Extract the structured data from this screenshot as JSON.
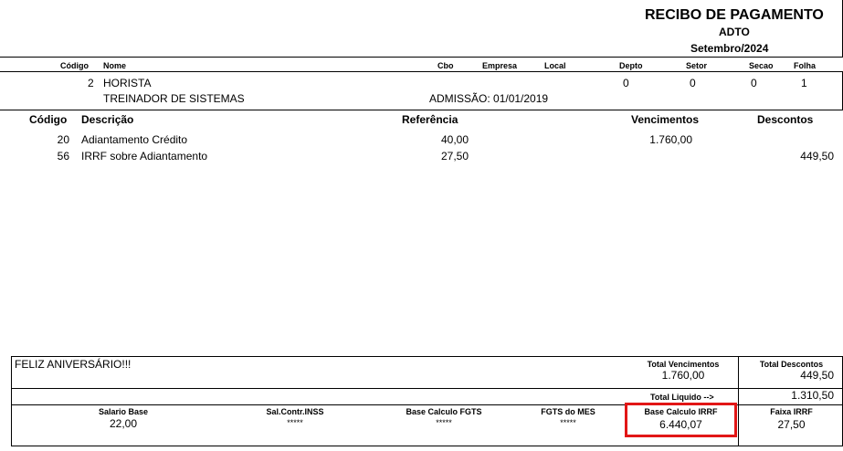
{
  "header": {
    "title": "RECIBO DE PAGAMENTO",
    "subtitle": "ADTO",
    "period": "Setembro/2024"
  },
  "employee_columns": {
    "codigo": "Código",
    "nome": "Nome",
    "cbo": "Cbo",
    "empresa": "Empresa",
    "local": "Local",
    "depto": "Depto",
    "setor": "Setor",
    "secao": "Secao",
    "folha": "Folha"
  },
  "employee": {
    "codigo": "2",
    "nome": "HORISTA",
    "cargo": "TREINADOR DE SISTEMAS",
    "admissao": "ADMISSÃO: 01/01/2019",
    "depto": "0",
    "setor": "0",
    "secao": "0",
    "folha": "1"
  },
  "items_columns": {
    "codigo": "Código",
    "descricao": "Descrição",
    "referencia": "Referência",
    "vencimentos": "Vencimentos",
    "descontos": "Descontos"
  },
  "items": [
    {
      "codigo": "20",
      "descricao": "Adiantamento Crédito",
      "referencia": "40,00",
      "vencimentos": "1.760,00",
      "descontos": ""
    },
    {
      "codigo": "56",
      "descricao": "IRRF sobre Adiantamento",
      "referencia": "27,50",
      "vencimentos": "",
      "descontos": "449,50"
    }
  ],
  "footer": {
    "message": "FELIZ ANIVERSÁRIO!!!",
    "total_vencimentos_label": "Total Vencimentos",
    "total_vencimentos": "1.760,00",
    "total_descontos_label": "Total Descontos",
    "total_descontos": "449,50",
    "total_liquido_label": "Total Liquido -->",
    "total_liquido": "1.310,50",
    "salario_base_label": "Salario Base",
    "salario_base": "22,00",
    "sal_contr_inss_label": "Sal.Contr.INSS",
    "sal_contr_inss": "*****",
    "base_fgts_label": "Base Calculo FGTS",
    "base_fgts": "*****",
    "fgts_mes_label": "FGTS do MES",
    "fgts_mes": "*****",
    "base_irrf_label": "Base Calculo IRRF",
    "base_irrf": "6.440,07",
    "faixa_irrf_label": "Faixa IRRF",
    "faixa_irrf": "27,50"
  },
  "colors": {
    "highlight": "#e21616"
  }
}
